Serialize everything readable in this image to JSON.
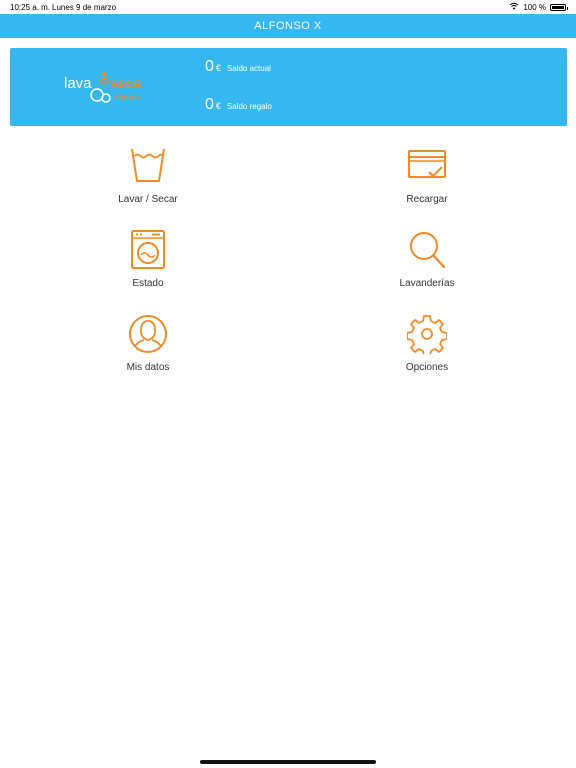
{
  "status_bar": {
    "time": "10:25 a. m.",
    "date": "Lunes 9 de marzo",
    "battery": "100 %"
  },
  "header": {
    "title": "ALFONSO X"
  },
  "balance": {
    "logo_text_1": "lava",
    "logo_text_2": "seca",
    "logo_text_3": "ress",
    "actual_amount": "0",
    "actual_currency": "€",
    "actual_label": "Saldo actual",
    "gift_amount": "0",
    "gift_currency": "€",
    "gift_label": "Saldo regalo"
  },
  "menu": {
    "wash": "Lavar / Secar",
    "recharge": "Recargar",
    "status": "Estado",
    "laundries": "Lavanderías",
    "my_data": "Mis datos",
    "options": "Opciones"
  },
  "colors": {
    "accent_blue": "#36b7f0",
    "icon_orange": "#f08a24"
  }
}
